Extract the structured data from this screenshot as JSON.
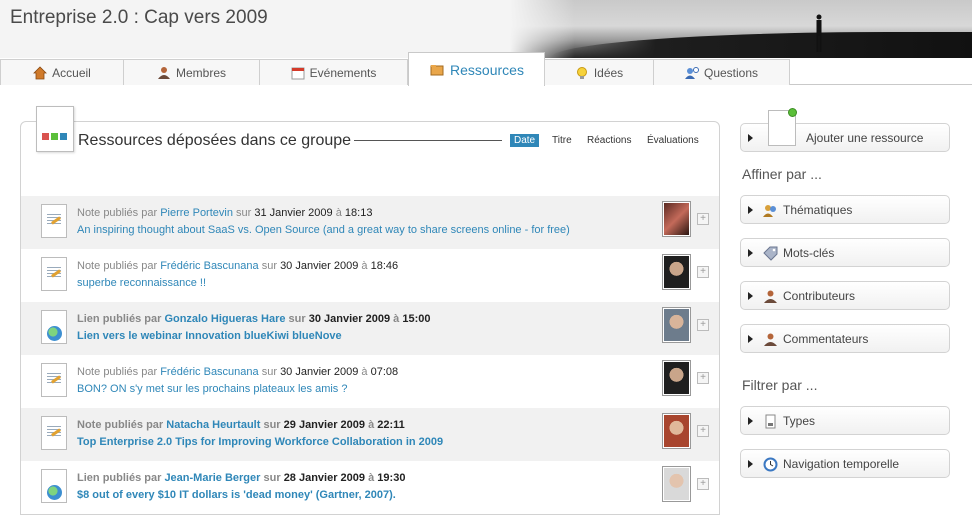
{
  "header": {
    "title": "Entreprise 2.0 : Cap vers 2009"
  },
  "tabs": [
    {
      "label": "Accueil",
      "icon": "house-icon"
    },
    {
      "label": "Membres",
      "icon": "user-icon"
    },
    {
      "label": "Evénements",
      "icon": "calendar-icon"
    },
    {
      "label": "Ressources",
      "icon": "folder-icon",
      "active": true
    },
    {
      "label": "Idées",
      "icon": "lightbulb-icon"
    },
    {
      "label": "Questions",
      "icon": "question-user-icon"
    }
  ],
  "panel": {
    "title": "Ressources déposées dans ce groupe",
    "sort_options": [
      {
        "label": "Date",
        "active": true
      },
      {
        "label": "Titre"
      },
      {
        "label": "Réactions"
      },
      {
        "label": "Évaluations"
      }
    ]
  },
  "resources": [
    {
      "type_label": "Note",
      "published_by": "publiés par",
      "author": "Pierre Portevin",
      "on": "sur",
      "date": "31 Janvier 2009",
      "at": "à",
      "time": "18:13",
      "title": "An inspiring thought about SaaS vs. Open Source (and a great way to share screens online - for free)",
      "kind": "note",
      "unread": false
    },
    {
      "type_label": "Note",
      "published_by": "publiés par",
      "author": "Frédéric Bascunana",
      "on": "sur",
      "date": "30 Janvier 2009",
      "at": "à",
      "time": "18:46",
      "title": "superbe reconnaissance !!",
      "kind": "note",
      "unread": false
    },
    {
      "type_label": "Lien",
      "published_by": "publiés par",
      "author": "Gonzalo Higueras Hare",
      "on": "sur",
      "date": "30 Janvier 2009",
      "at": "à",
      "time": "15:00",
      "title": "Lien vers le webinar Innovation blueKiwi blueNove",
      "kind": "link",
      "unread": true
    },
    {
      "type_label": "Note",
      "published_by": "publiés par",
      "author": "Frédéric Bascunana",
      "on": "sur",
      "date": "30 Janvier 2009",
      "at": "à",
      "time": "07:08",
      "title": "BON? ON s'y met sur les prochains plateaux les amis ?",
      "kind": "note",
      "unread": false
    },
    {
      "type_label": "Note",
      "published_by": "publiés par",
      "author": "Natacha Heurtault",
      "on": "sur",
      "date": "29 Janvier 2009",
      "at": "à",
      "time": "22:11",
      "title": "Top Enterprise 2.0 Tips for Improving Workforce Collaboration in 2009",
      "kind": "note",
      "unread": true
    },
    {
      "type_label": "Lien",
      "published_by": "publiés par",
      "author": "Jean-Marie Berger",
      "on": "sur",
      "date": "28 Janvier 2009",
      "at": "à",
      "time": "19:30",
      "title": "$8 out of every $10 IT dollars is 'dead money' (Gartner, 2007).",
      "kind": "link",
      "unread": true
    }
  ],
  "sidebar": {
    "add_button": "Ajouter une ressource",
    "refine_heading": "Affiner par ...",
    "refine_items": [
      {
        "label": "Thématiques",
        "icon": "users-icon"
      },
      {
        "label": "Mots-clés",
        "icon": "tag-icon"
      },
      {
        "label": "Contributeurs",
        "icon": "user-icon"
      },
      {
        "label": "Commentateurs",
        "icon": "user-icon"
      }
    ],
    "filter_heading": "Filtrer par ...",
    "filter_items": [
      {
        "label": "Types",
        "icon": "document-icon"
      },
      {
        "label": "Navigation temporelle",
        "icon": "clock-icon"
      }
    ]
  },
  "colors": {
    "accent": "#2f87b8",
    "row_alt": "#f1f1f1"
  }
}
